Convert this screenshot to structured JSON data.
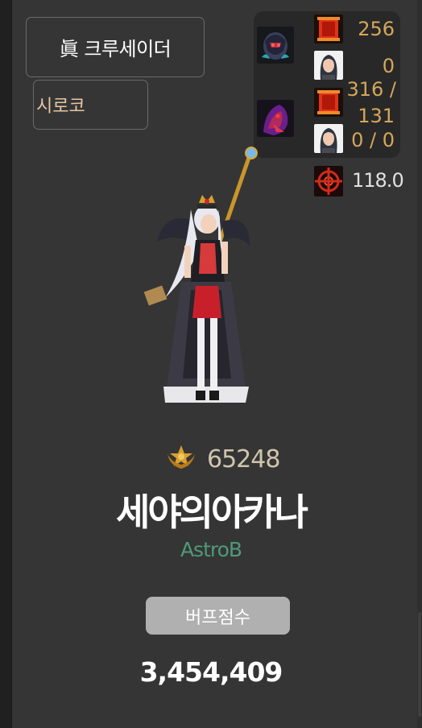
{
  "class_button": {
    "label": "眞 크루세이더"
  },
  "server_button": {
    "label": "시로코"
  },
  "stats": {
    "row1_value": "256",
    "row2_value": "0",
    "row3_value_line1": "316 /",
    "row3_value_line2": "131",
    "row4_value": "0 / 0",
    "damage_value": "118.0"
  },
  "fame": {
    "value": "65248"
  },
  "character": {
    "name": "세야의아카나",
    "guild": "AstroB"
  },
  "buff": {
    "label": "버프점수",
    "score": "3,454,409"
  },
  "colors": {
    "accent_gold": "#d4a75a",
    "guild_green": "#4f9a78",
    "name_peach": "#e8c8a2"
  }
}
